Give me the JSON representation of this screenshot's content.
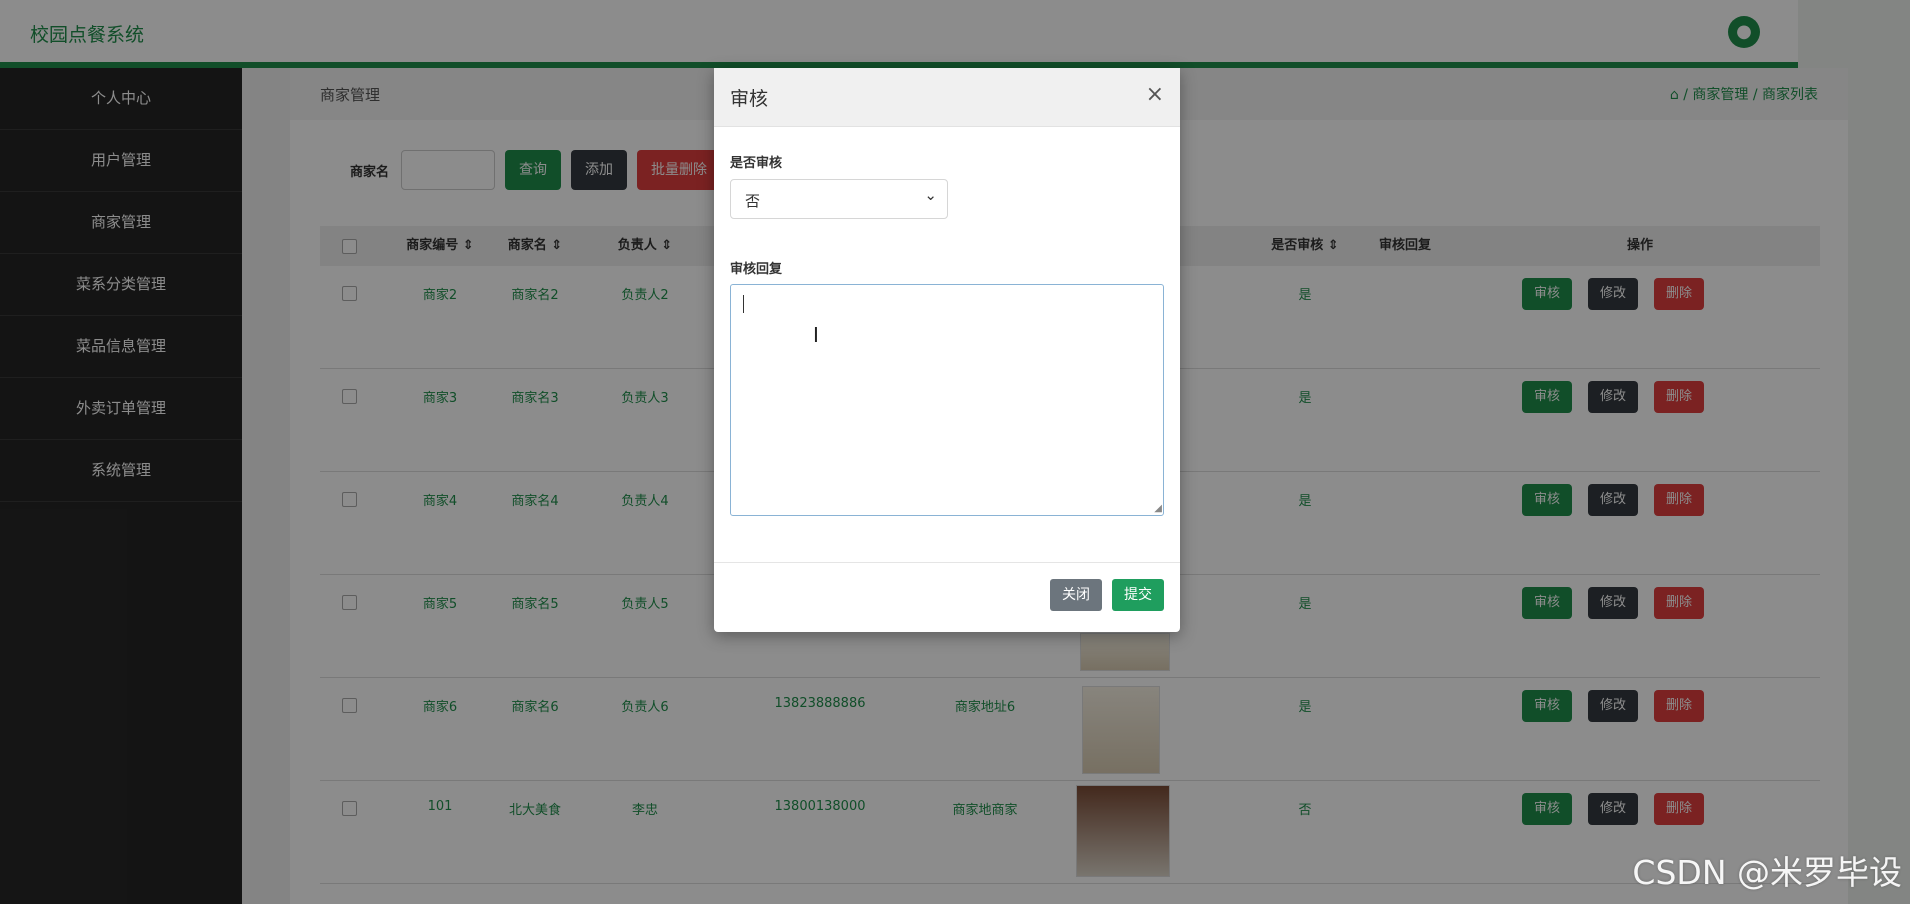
{
  "app": {
    "title": "校园点餐系统"
  },
  "sidebar": {
    "items": [
      {
        "label": "个人中心"
      },
      {
        "label": "用户管理"
      },
      {
        "label": "商家管理"
      },
      {
        "label": "菜系分类管理"
      },
      {
        "label": "菜品信息管理"
      },
      {
        "label": "外卖订单管理"
      },
      {
        "label": "系统管理"
      }
    ]
  },
  "breadcrumb": {
    "title": "商家管理",
    "path": "⌂ / 商家管理 / 商家列表"
  },
  "toolbar": {
    "search_label": "商家名",
    "query_label": "查询",
    "add_label": "添加",
    "batch_delete_label": "批量删除"
  },
  "table": {
    "headers": {
      "id": "商家编号 ⇕",
      "name": "商家名 ⇕",
      "owner": "负责人 ⇕",
      "audit": "是否审核 ⇕",
      "reply": "审核回复",
      "ops": "操作"
    },
    "actions": {
      "audit": "审核",
      "edit": "修改",
      "delete": "删除"
    },
    "rows": [
      {
        "id": "商家2",
        "name": "商家名2",
        "owner": "负责人2",
        "phone": "",
        "address": "",
        "audited": "是"
      },
      {
        "id": "商家3",
        "name": "商家名3",
        "owner": "负责人3",
        "phone": "",
        "address": "",
        "audited": "是"
      },
      {
        "id": "商家4",
        "name": "商家名4",
        "owner": "负责人4",
        "phone": "",
        "address": "",
        "audited": "是"
      },
      {
        "id": "商家5",
        "name": "商家名5",
        "owner": "负责人5",
        "phone": "",
        "address": "",
        "audited": "是"
      },
      {
        "id": "商家6",
        "name": "商家名6",
        "owner": "负责人6",
        "phone": "13823888886",
        "address": "商家地址6",
        "audited": "是"
      },
      {
        "id": "101",
        "name": "北大美食",
        "owner": "李忠",
        "phone": "13800138000",
        "address": "商家地商家",
        "audited": "否"
      }
    ]
  },
  "modal": {
    "title": "审核",
    "close_icon": "×",
    "audit_label": "是否审核",
    "audit_value": "否",
    "reply_label": "审核回复",
    "reply_value": "",
    "close_button": "关闭",
    "submit_button": "提交"
  },
  "watermark": "CSDN @米罗毕设",
  "colors": {
    "accent": "#1f8f4c",
    "danger": "#e03e3e",
    "dark": "#343a40",
    "sidebar": "#262626"
  }
}
